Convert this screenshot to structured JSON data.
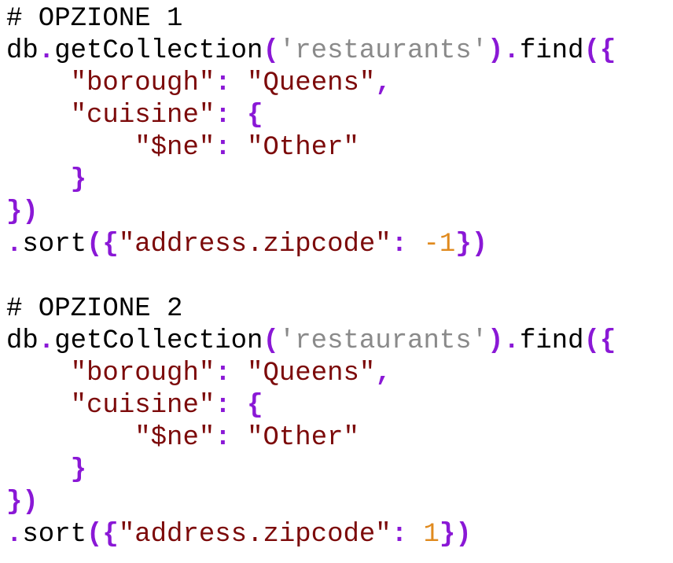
{
  "options": [
    {
      "heading": "# OPZIONE 1",
      "db": "db",
      "method": "getCollection",
      "collection": "'restaurants'",
      "find": "find",
      "borough_key": "\"borough\"",
      "borough_value": "\"Queens\"",
      "cuisine_key": "\"cuisine\"",
      "ne_key": "\"$ne\"",
      "ne_value": "\"Other\"",
      "sort": "sort",
      "sort_key": "\"address.zipcode\"",
      "sort_minus": "-",
      "sort_value": "1"
    },
    {
      "heading": "# OPZIONE 2",
      "db": "db",
      "method": "getCollection",
      "collection": "'restaurants'",
      "find": "find",
      "borough_key": "\"borough\"",
      "borough_value": "\"Queens\"",
      "cuisine_key": "\"cuisine\"",
      "ne_key": "\"$ne\"",
      "ne_value": "\"Other\"",
      "sort": "sort",
      "sort_key": "\"address.zipcode\"",
      "sort_minus": "",
      "sort_value": "1"
    }
  ]
}
